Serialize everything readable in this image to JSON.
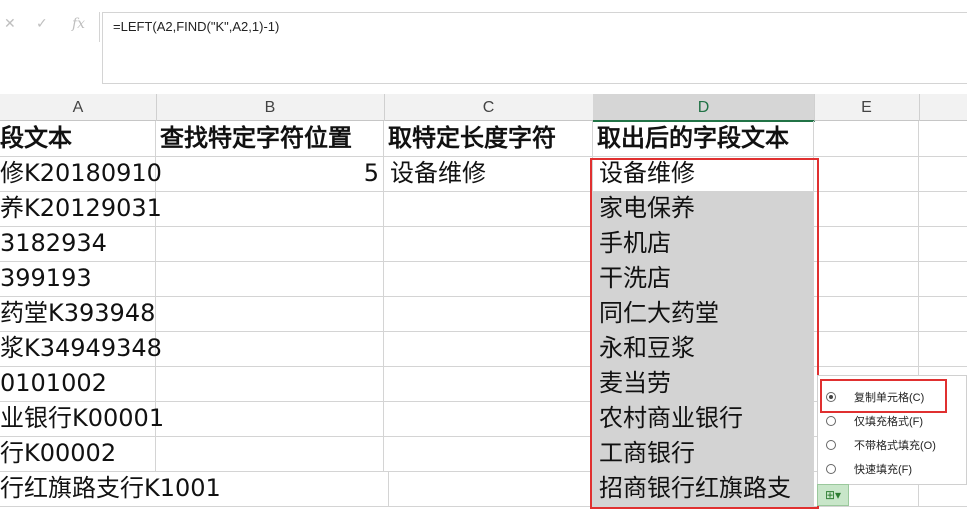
{
  "formula_bar": {
    "cancel_icon": "cancel-icon",
    "enter_icon": "check-icon",
    "fx_label": "fx",
    "formula": "=LEFT(A2,FIND(\"K\",A2,1)-1)"
  },
  "columns": [
    "A",
    "B",
    "C",
    "D",
    "E"
  ],
  "selected_column": "D",
  "header_row": {
    "A": "段文本",
    "B": "查找特定字符位置",
    "C": "取特定长度字符",
    "D": "取出后的字段文本"
  },
  "rows": [
    {
      "A": "修K20180910",
      "B": "5",
      "C": "设备维修",
      "D": "设备维修"
    },
    {
      "A": "养K20129031",
      "B": "",
      "C": "",
      "D": "家电保养"
    },
    {
      "A": "3182934",
      "B": "",
      "C": "",
      "D": "手机店"
    },
    {
      "A": "399193",
      "B": "",
      "C": "",
      "D": "干洗店"
    },
    {
      "A": "药堂K393948",
      "B": "",
      "C": "",
      "D": "同仁大药堂"
    },
    {
      "A": "浆K34949348",
      "B": "",
      "C": "",
      "D": "永和豆浆"
    },
    {
      "A": "0101002",
      "B": "",
      "C": "",
      "D": "麦当劳"
    },
    {
      "A": "业银行K00001",
      "B": "",
      "C": "",
      "D": "农村商业银行"
    },
    {
      "A": "行K00002",
      "B": "",
      "C": "",
      "D": "工商银行"
    },
    {
      "A": "行红旗路支行K1001",
      "B": "",
      "C": "",
      "D": "招商银行红旗路支"
    }
  ],
  "paste_options": {
    "items": [
      {
        "label": "复制单元格(C)",
        "selected": true
      },
      {
        "label": "仅填充格式(F)",
        "selected": false
      },
      {
        "label": "不带格式填充(O)",
        "selected": false
      },
      {
        "label": "快速填充(F)",
        "selected": false
      }
    ],
    "button_icon": "paste-options-icon"
  }
}
